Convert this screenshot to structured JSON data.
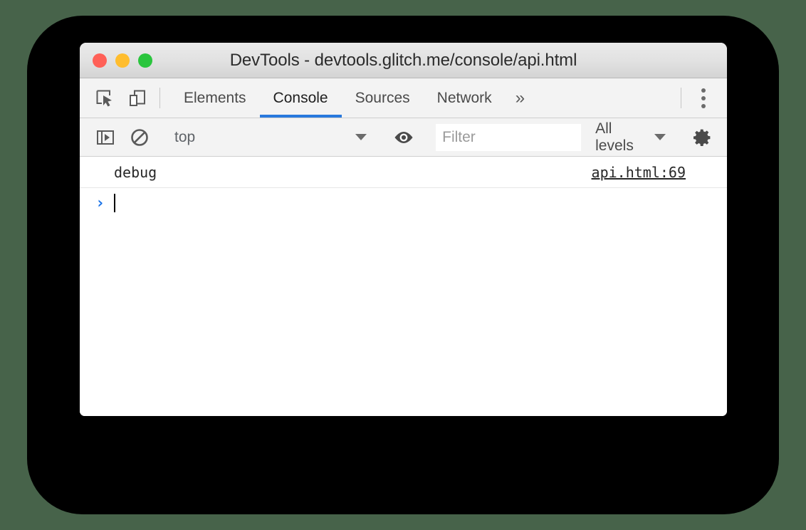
{
  "window": {
    "title": "DevTools - devtools.glitch.me/console/api.html",
    "traffic_lights": [
      {
        "name": "close",
        "color": "#ff6057"
      },
      {
        "name": "minimize",
        "color": "#ffbd2e"
      },
      {
        "name": "maximize",
        "color": "#2ac53d"
      }
    ]
  },
  "toolbar": {
    "inspect_icon": "inspect-element-icon",
    "device_icon": "device-toolbar-icon",
    "tabs": [
      {
        "label": "Elements",
        "active": false
      },
      {
        "label": "Console",
        "active": true
      },
      {
        "label": "Sources",
        "active": false
      },
      {
        "label": "Network",
        "active": false
      }
    ],
    "more_tabs_label": "»",
    "menu_icon": "kebab-menu-icon",
    "active_tab_color": "#2979dd"
  },
  "console_toolbar": {
    "sidebar_icon": "console-sidebar-icon",
    "clear_icon": "clear-console-icon",
    "context": {
      "value": "top",
      "caret": "chevron-down-icon"
    },
    "eye_icon": "live-expression-eye-icon",
    "filter": {
      "value": "",
      "placeholder": "Filter"
    },
    "levels": {
      "label": "All levels",
      "caret": "chevron-down-icon"
    },
    "settings_icon": "gear-icon"
  },
  "console": {
    "messages": [
      {
        "text": "debug",
        "source": "api.html:69"
      }
    ],
    "prompt": {
      "arrow": "›",
      "value": "",
      "arrow_color": "#1a73e8"
    }
  },
  "colors": {
    "backdrop": "#47634a",
    "frame": "#000000",
    "toolbar_bg": "#f3f3f3",
    "titlebar_bg": "#e2e2e2"
  }
}
